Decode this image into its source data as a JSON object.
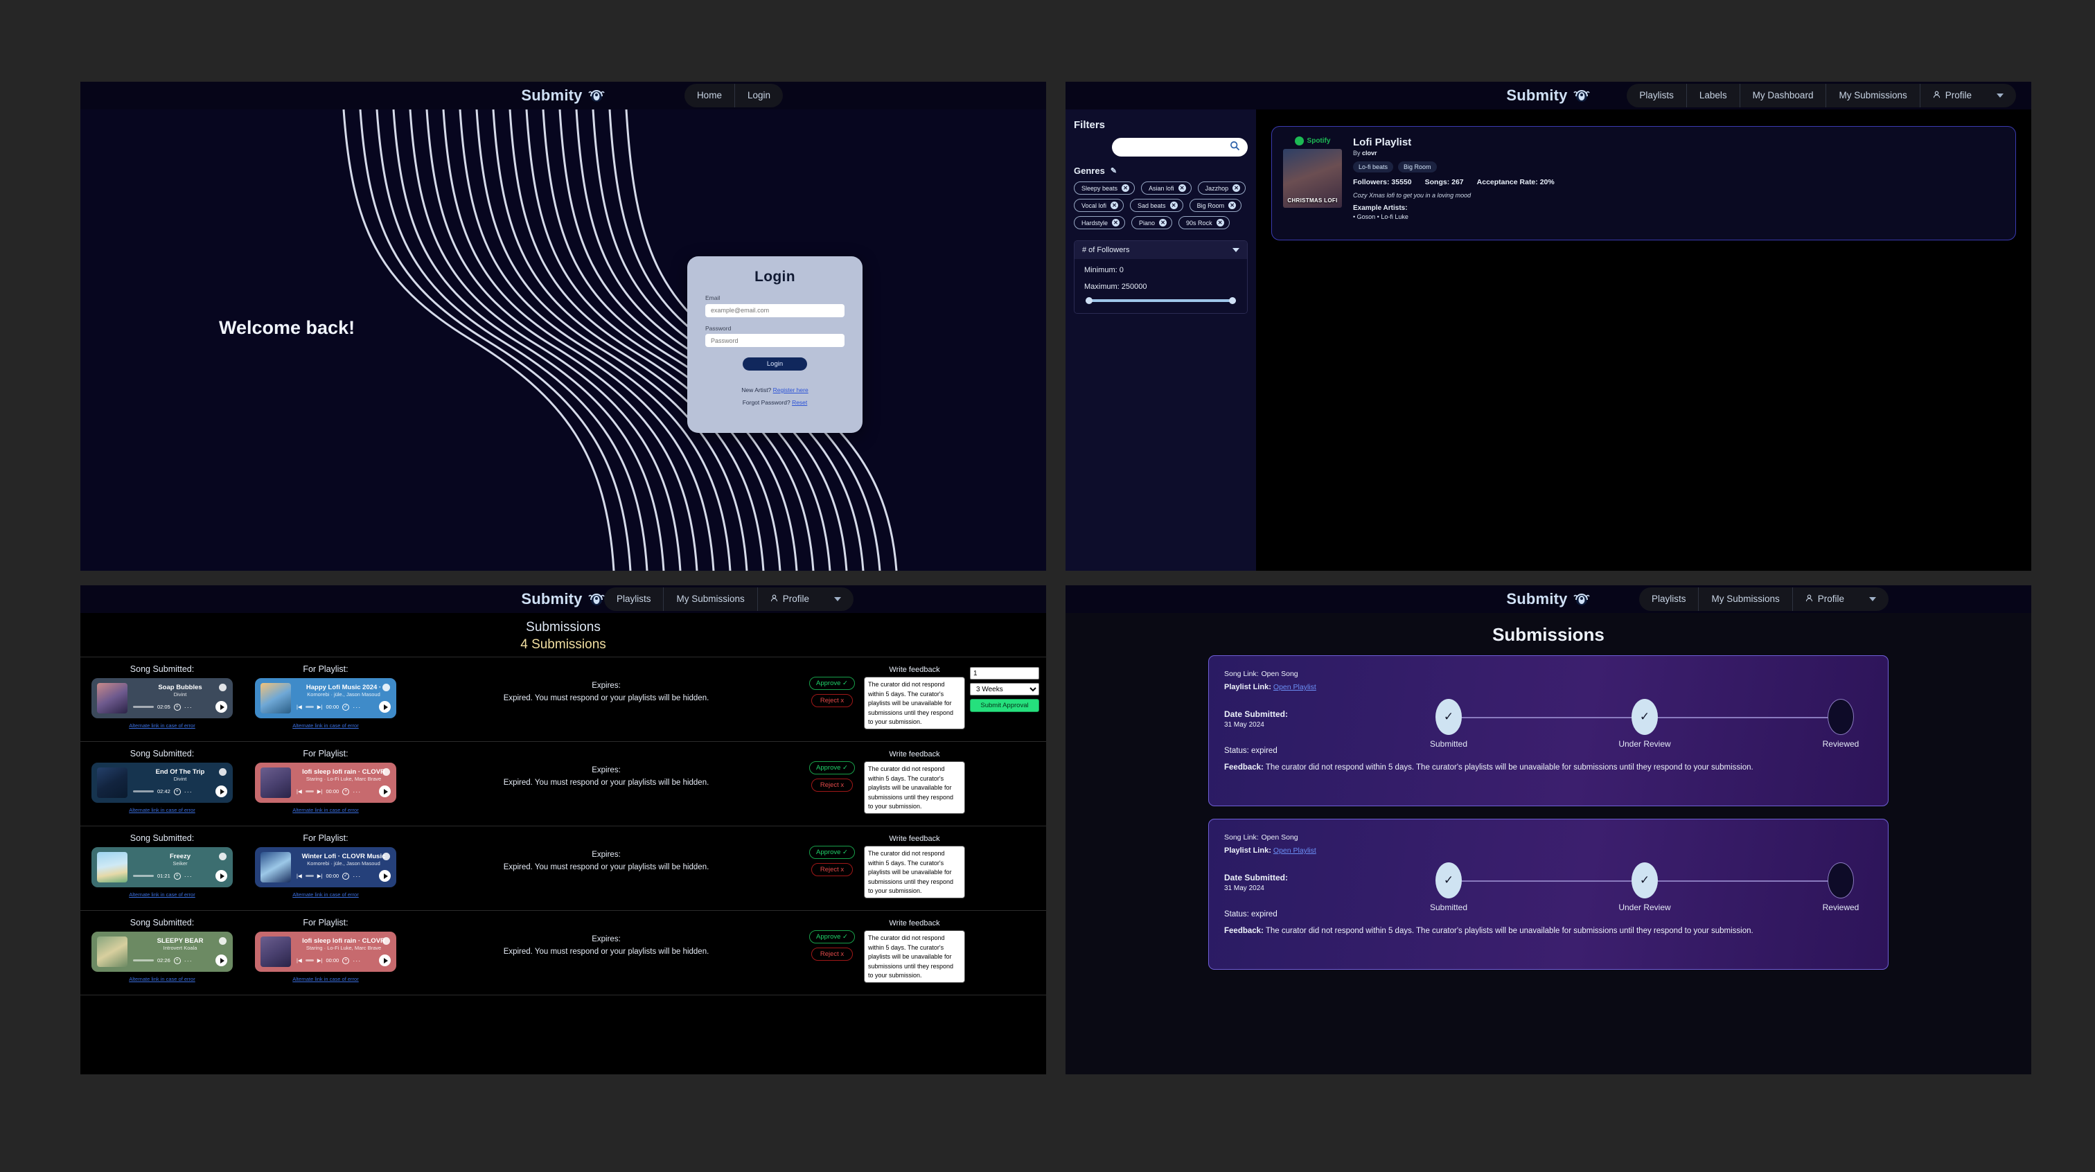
{
  "brand": {
    "name": "Submity",
    "logo_icon": "headphones-logo-icon"
  },
  "login_view": {
    "nav": [
      {
        "label": "Home"
      },
      {
        "label": "Login"
      }
    ],
    "hero_heading": "Welcome back!",
    "card": {
      "title": "Login",
      "email_label": "Email",
      "email_value": "",
      "email_placeholder": "example@email.com",
      "password_label": "Password",
      "password_value": "",
      "password_placeholder": "Password",
      "submit_label": "Login",
      "register_prompt": "New Artist?",
      "register_link": "Register here",
      "forgot_prompt": "Forgot Password?",
      "forgot_link": "Reset"
    }
  },
  "playlists_view": {
    "nav": [
      {
        "label": "Playlists"
      },
      {
        "label": "Labels"
      },
      {
        "label": "My Dashboard"
      },
      {
        "label": "My Submissions"
      },
      {
        "label": "Profile",
        "icon": "person-icon",
        "caret": true
      }
    ],
    "filters": {
      "title": "Filters",
      "search_value": "",
      "search_placeholder": "",
      "search_icon": "search-icon",
      "genres_label": "Genres",
      "edit_icon": "pencil-icon",
      "genres": [
        "Sleepy beats",
        "Asian lofi",
        "Jazzhop",
        "Vocal lofi",
        "Sad beats",
        "Big Room",
        "Hardstyle",
        "Piano",
        "90s Rock"
      ],
      "followers": {
        "header": "# of Followers",
        "minimum": "Minimum: 0",
        "maximum": "Maximum: 250000"
      }
    },
    "playlist": {
      "platform": "Spotify",
      "cover_label": "CHRISTMAS LOFI",
      "title": "Lofi Playlist",
      "by_prefix": "By",
      "by": "clovr",
      "tags": [
        "Lo-fi beats",
        "Big Room"
      ],
      "followers": "Followers: 35550",
      "songs": "Songs: 267",
      "acceptance": "Acceptance Rate: 20%",
      "description": "Cozy Xmas lofi to get you in a loving mood",
      "example_artists_label": "Example Artists:",
      "example_artists": "• Goson • Lo-fi Luke"
    }
  },
  "submissions_table_view": {
    "nav": [
      {
        "label": "Playlists"
      },
      {
        "label": "My Submissions"
      },
      {
        "label": "Profile",
        "icon": "person-icon",
        "caret": true
      }
    ],
    "heading": "Submissions",
    "count_heading": "4 Submissions",
    "col_song_label": "Song Submitted:",
    "col_playlist_label": "For Playlist:",
    "alt_link_label": "Alternate link in case of error",
    "expires_label": "Expires:",
    "expires_text": "Expired. You must respond or your playlists will be hidden.",
    "approve_label": "Approve ✓",
    "reject_label": "Reject x",
    "feedback_label": "Write feedback",
    "feedback_text": "The curator did not respond within 5 days. The curator's playlists will be unavailable for submissions until they respond to your submission.",
    "number_value": "1",
    "duration_value": "3 Weeks",
    "submit_label": "Submit Approval",
    "rows": [
      {
        "song": {
          "title": "Soap Bubbles",
          "artist": "Divint",
          "time": "02:05",
          "color": "#3c4a5c"
        },
        "playlist": {
          "title": "Happy Lofi Music 2024 ·",
          "artist": "Komorebi · jüle., Jason Masoud",
          "time": "00:00",
          "color": "#3f8bc9"
        }
      },
      {
        "song": {
          "title": "End Of The Trip",
          "artist": "Divint",
          "time": "02:42",
          "color": "#16344f"
        },
        "playlist": {
          "title": "lofi sleep lofi rain · CLOVR",
          "artist": "Staring · Lo-Fi Luke, Marc Brave",
          "time": "00:00",
          "color": "#c76a6e"
        }
      },
      {
        "song": {
          "title": "Freezy",
          "artist": "Seiker",
          "time": "01:21",
          "color": "#3c6e70"
        },
        "playlist": {
          "title": "Winter Lofi · CLOVR Music",
          "artist": "Komorebi · jüle., Jason Masoud",
          "time": "00:00",
          "color": "#25407a"
        }
      },
      {
        "song": {
          "title": "SLEEPY BEAR",
          "artist": "Introvert Koala",
          "time": "02:26",
          "color": "#6c8a63"
        },
        "playlist": {
          "title": "lofi sleep lofi rain · CLOVR",
          "artist": "Staring · Lo-Fi Luke, Marc Brave",
          "time": "00:00",
          "color": "#c76a6e"
        }
      }
    ]
  },
  "submissions_timeline_view": {
    "nav": [
      {
        "label": "Playlists"
      },
      {
        "label": "My Submissions"
      },
      {
        "label": "Profile",
        "icon": "person-icon",
        "caret": true
      }
    ],
    "title": "Submissions",
    "cards": [
      {
        "song_link_label": "Song Link:",
        "song_link": "Open Song",
        "playlist_link_label": "Playlist Link:",
        "playlist_link": "Open Playlist",
        "date_label": "Date Submitted:",
        "date": "31 May 2024",
        "status": "Status: expired",
        "feedback_label": "Feedback:",
        "feedback": "The curator did not respond within 5 days. The curator's playlists will be unavailable for submissions until they respond to your submission.",
        "steps": [
          {
            "label": "Submitted",
            "done": true
          },
          {
            "label": "Under Review",
            "done": true
          },
          {
            "label": "Reviewed",
            "done": false
          }
        ]
      },
      {
        "song_link_label": "Song Link:",
        "song_link": "Open Song",
        "playlist_link_label": "Playlist Link:",
        "playlist_link": "Open Playlist",
        "date_label": "Date Submitted:",
        "date": "31 May 2024",
        "status": "Status: expired",
        "feedback_label": "Feedback:",
        "feedback": "The curator did not respond within 5 days. The curator's playlists will be unavailable for submissions until they respond to your submission.",
        "steps": [
          {
            "label": "Submitted",
            "done": true
          },
          {
            "label": "Under Review",
            "done": true
          },
          {
            "label": "Reviewed",
            "done": false
          }
        ]
      }
    ]
  },
  "colors": {
    "accent_blue": "#3b6fe0",
    "spotify_green": "#1db954",
    "approve_green": "#20d26a",
    "reject_red": "#e24a4a",
    "submit_green": "#25e07d",
    "count_gold": "#f2dfa2",
    "panel_purple": "#3c1f6e"
  }
}
